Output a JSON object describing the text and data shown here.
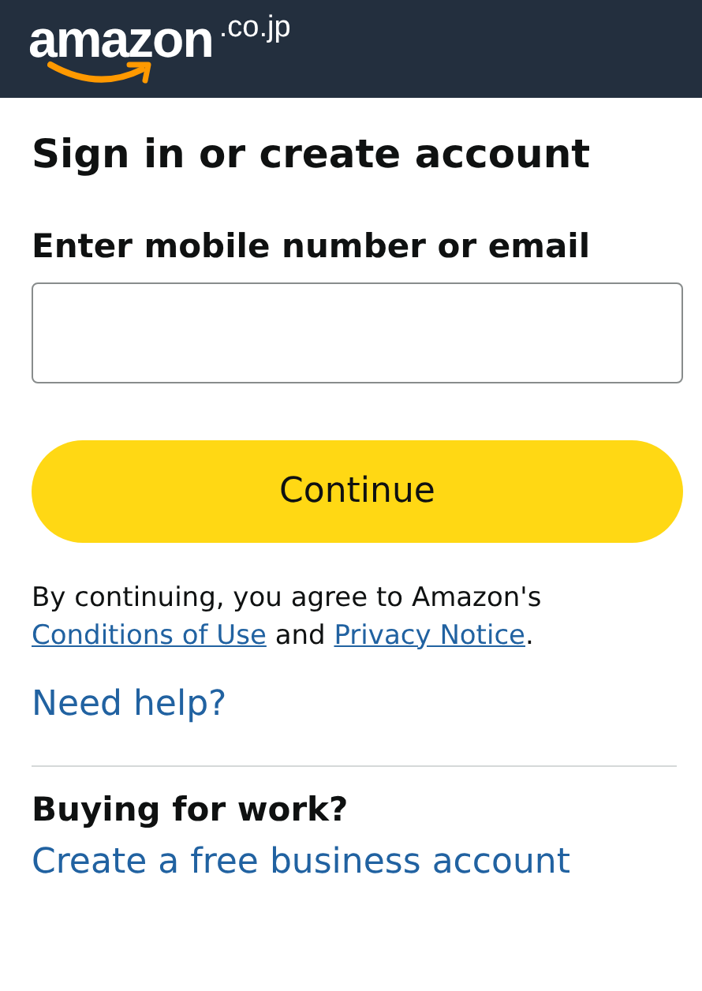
{
  "header": {
    "logo_text": "amazon",
    "logo_domain": ".co.jp"
  },
  "title": "Sign in or create account",
  "field": {
    "label": "Enter mobile number or email"
  },
  "continue_button": "Continue",
  "terms": {
    "prefix": "By continuing, you agree to Amazon's",
    "link_1": "Conditions of Use",
    "middle": "and",
    "link_2": "Privacy Notice",
    "suffix": "."
  },
  "help_link": "Need help?",
  "business": {
    "heading": "Buying for work?",
    "link": "Create a free business account"
  }
}
